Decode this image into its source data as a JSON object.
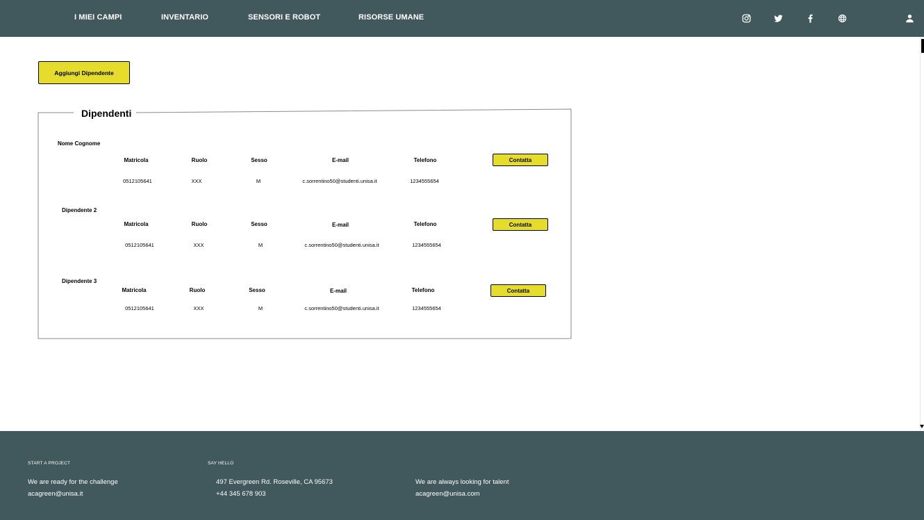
{
  "nav": {
    "items": [
      "I MIEI CAMPI",
      "INVENTARIO",
      "SENSORI E ROBOT",
      "RISORSE UMANE"
    ],
    "icons": [
      "instagram-icon",
      "twitter-icon",
      "facebook-icon",
      "globe-icon",
      "user-icon"
    ]
  },
  "colors": {
    "nav_bg": "#41585c",
    "accent": "#e6dc2b",
    "text_light": "#ffffff"
  },
  "actions": {
    "add_employee": "Aggiungi Dipendente"
  },
  "panel": {
    "title": "Dipendenti",
    "columns": [
      "Matricola",
      "Ruolo",
      "Sesso",
      "E-mail",
      "Telefono"
    ],
    "contact_label": "Contatta",
    "employees": [
      {
        "name": "Nome Cognome",
        "matricola": "0512105641",
        "ruolo": "XXX",
        "sesso": "M",
        "email": "c.sorrentino50@studenti.unisa.it",
        "telefono": "1234555654"
      },
      {
        "name": "Dipendente 2",
        "matricola": "0512105641",
        "ruolo": "XXX",
        "sesso": "M",
        "email": "c.sorrentino50@studenti.unisa.it",
        "telefono": "1234555654"
      },
      {
        "name": "Dipendente 3",
        "matricola": "0512105641",
        "ruolo": "XXX",
        "sesso": "M",
        "email": "c.sorrentino50@studenti.unisa.it",
        "telefono": "1234555654"
      }
    ]
  },
  "footer": {
    "col1": {
      "heading": "START A PROJECT",
      "line1": "We are ready for the challenge",
      "line2": "acagreen@unisa.it"
    },
    "col2": {
      "heading": "SAY HELLO",
      "line1": "497 Evergreen Rd. Roseville, CA 95673",
      "line2": "+44 345 678 903"
    },
    "col3": {
      "line1": "We are always looking for talent",
      "line2": "acagreen@unisa.com"
    }
  }
}
